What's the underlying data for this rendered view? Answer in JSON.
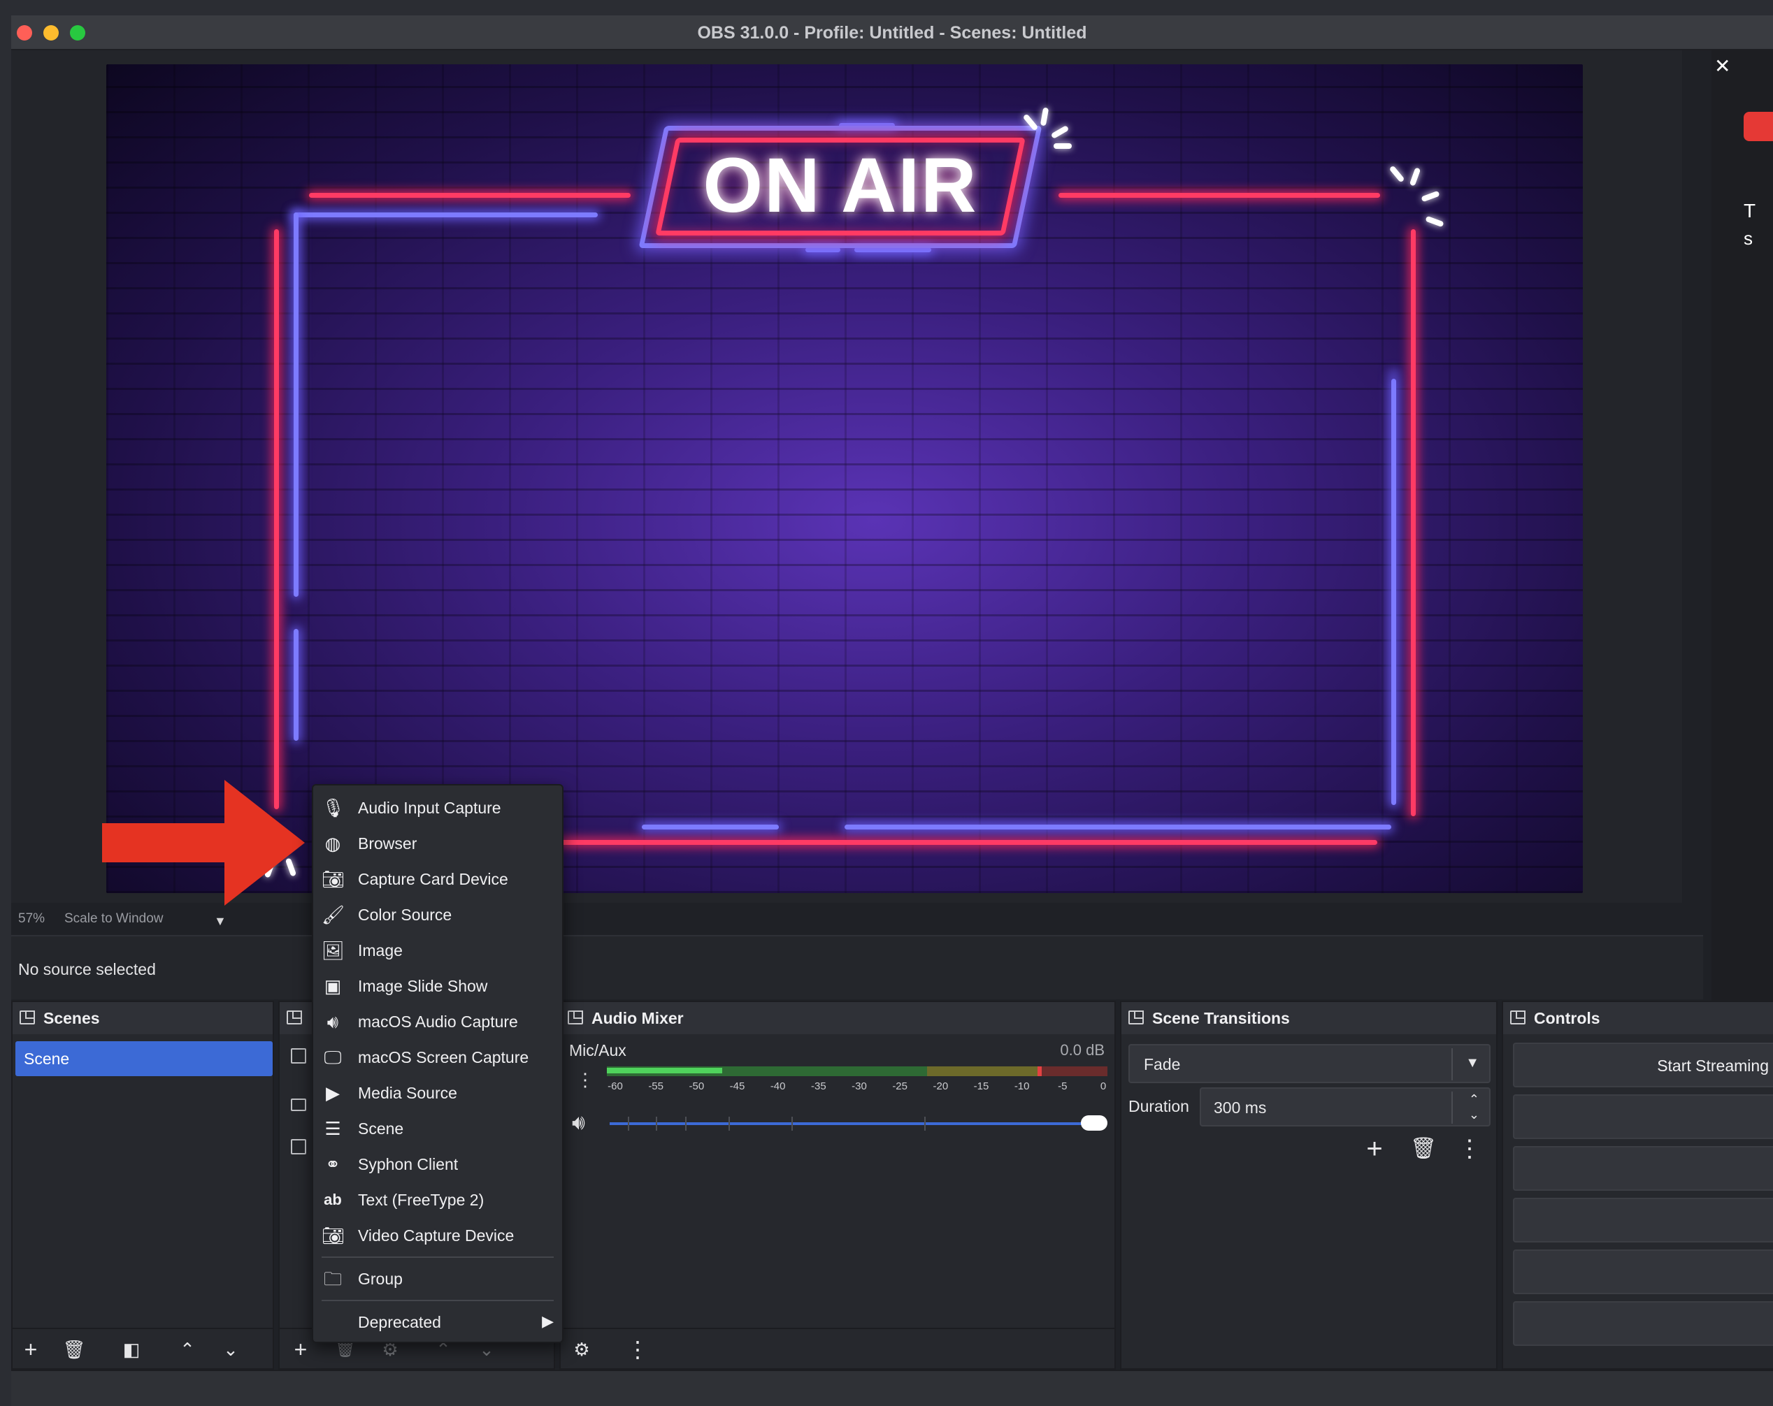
{
  "window": {
    "title": "OBS 31.0.0 - Profile: Untitled - Scenes: Untitled"
  },
  "preview": {
    "onair_text": "ON AIR",
    "zoom": "57%",
    "scale_mode": "Scale to Window"
  },
  "source_bar": {
    "status": "No source selected"
  },
  "docks": {
    "scenes": {
      "title": "Scenes",
      "items": [
        "Scene"
      ]
    },
    "audio_mixer": {
      "title": "Audio Mixer",
      "channel": "Mic/Aux",
      "level": "0.0 dB",
      "ticks": [
        "-60",
        "-55",
        "-50",
        "-45",
        "-40",
        "-35",
        "-30",
        "-25",
        "-20",
        "-15",
        "-10",
        "-5",
        "0"
      ]
    },
    "scene_transitions": {
      "title": "Scene Transitions",
      "transition": "Fade",
      "duration_label": "Duration",
      "duration_value": "300 ms"
    },
    "controls": {
      "title": "Controls",
      "start_streaming": "Start Streaming"
    }
  },
  "context_menu": {
    "items": [
      {
        "label": "Audio Input Capture",
        "icon": "microphone-icon"
      },
      {
        "label": "Browser",
        "icon": "globe-icon"
      },
      {
        "label": "Capture Card Device",
        "icon": "camera-icon"
      },
      {
        "label": "Color Source",
        "icon": "paintbrush-icon"
      },
      {
        "label": "Image",
        "icon": "image-icon"
      },
      {
        "label": "Image Slide Show",
        "icon": "slideshow-icon"
      },
      {
        "label": "macOS Audio Capture",
        "icon": "speaker-icon"
      },
      {
        "label": "macOS Screen Capture",
        "icon": "monitor-icon"
      },
      {
        "label": "Media Source",
        "icon": "play-icon"
      },
      {
        "label": "Scene",
        "icon": "list-icon"
      },
      {
        "label": "Syphon Client",
        "icon": "syphon-icon"
      },
      {
        "label": "Text (FreeType 2)",
        "icon": "text-ab-icon"
      },
      {
        "label": "Video Capture Device",
        "icon": "camera-icon"
      }
    ],
    "group_label": "Group",
    "deprecated_label": "Deprecated"
  },
  "right_edge": {
    "t": "T",
    "s": "s"
  },
  "colors": {
    "accent_blue": "#3c6ad6",
    "arrow_red": "#e53322",
    "neon_red": "#ff3b64",
    "neon_blue": "#7d7bff"
  }
}
